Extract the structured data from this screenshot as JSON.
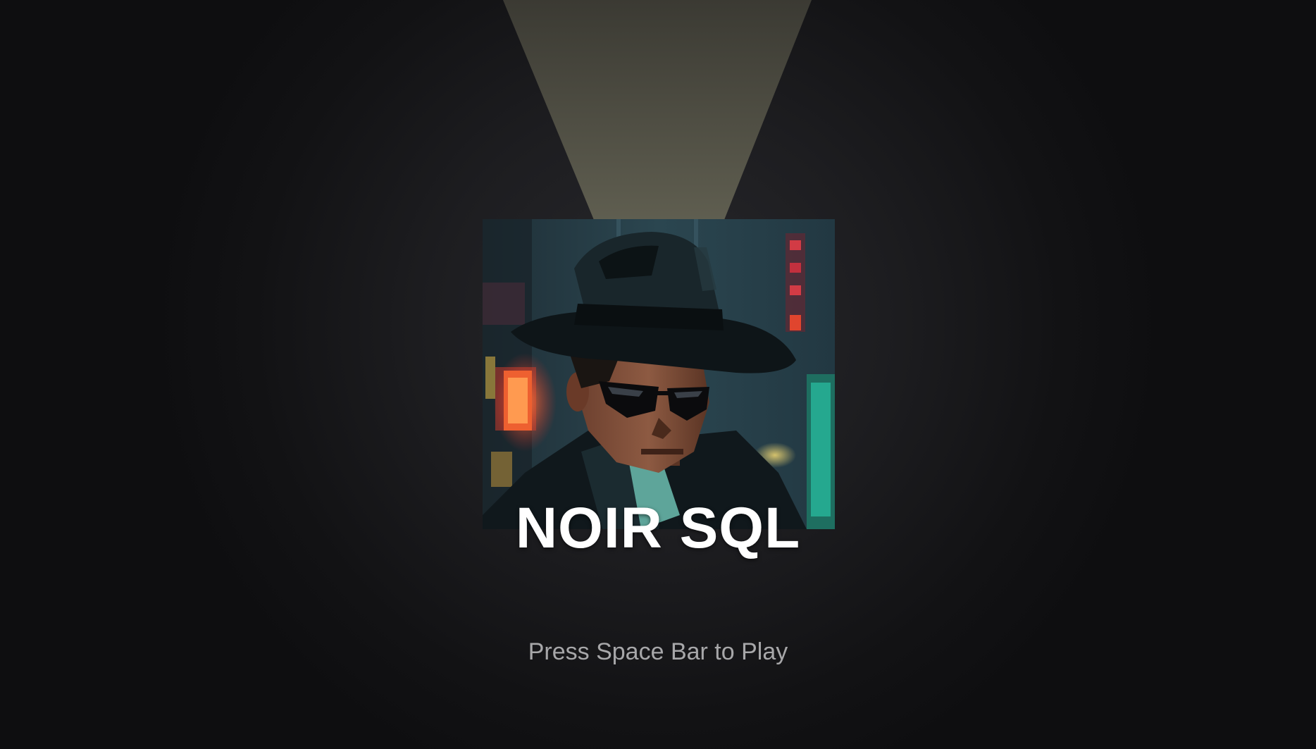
{
  "title_screen": {
    "game_title": "NOIR SQL",
    "start_prompt": "Press Space Bar to Play"
  },
  "hero_image": {
    "subject": "pixel-art detective in fedora and sunglasses with neon city background",
    "icon": "detective-portrait"
  },
  "colors": {
    "background": "#151517",
    "spotlight": "#6e6c5c",
    "title": "#ffffff",
    "prompt": "#a7a7a9",
    "neon_red": "#e0452e",
    "neon_teal": "#25a88f"
  }
}
